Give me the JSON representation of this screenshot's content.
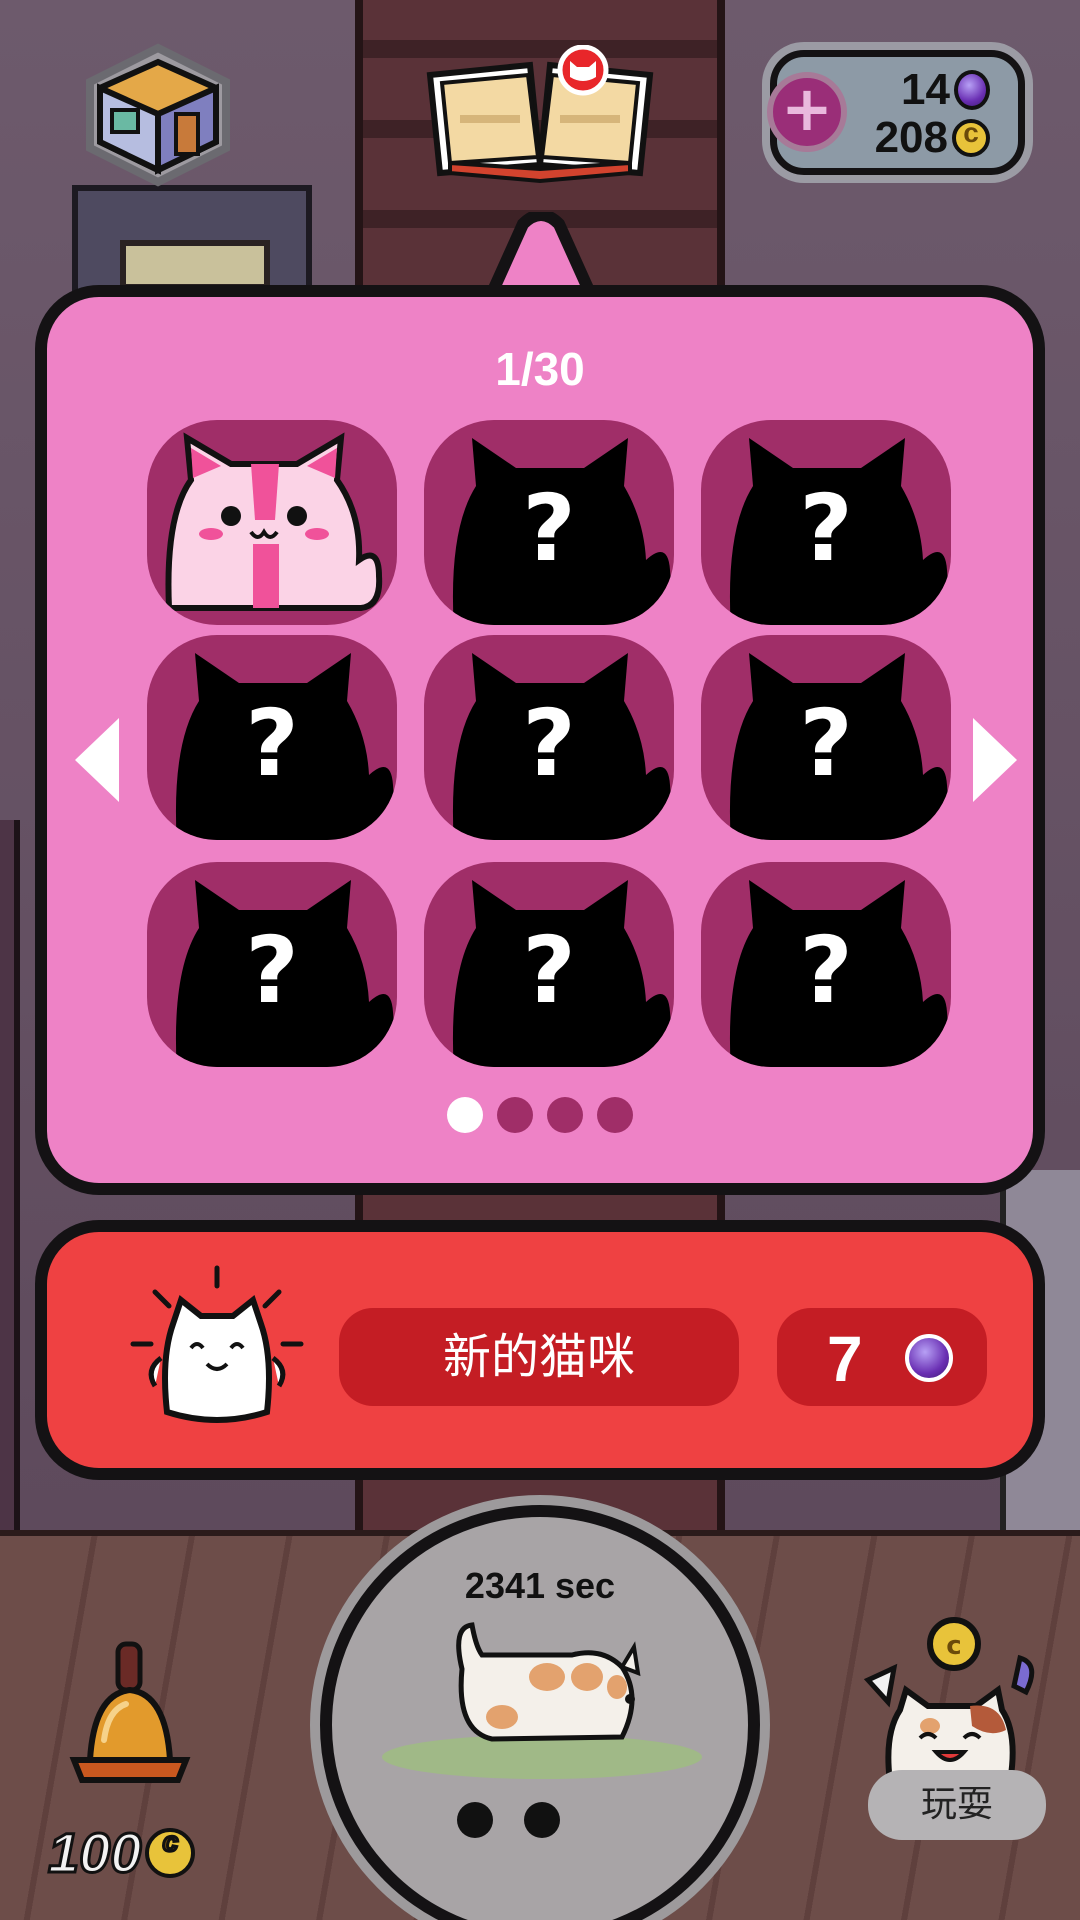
{
  "top_bar": {
    "gems": "14",
    "coins": "208",
    "plus_label": "+"
  },
  "album": {
    "page_indicator": "1/30",
    "cells": [
      {
        "state": "unlocked",
        "label": ""
      },
      {
        "state": "locked",
        "label": "?"
      },
      {
        "state": "locked",
        "label": "?"
      },
      {
        "state": "locked",
        "label": "?"
      },
      {
        "state": "locked",
        "label": "?"
      },
      {
        "state": "locked",
        "label": "?"
      },
      {
        "state": "locked",
        "label": "?"
      },
      {
        "state": "locked",
        "label": "?"
      },
      {
        "state": "locked",
        "label": "?"
      }
    ],
    "pages_total": 4,
    "active_page": 0
  },
  "new_cat": {
    "label": "新的猫咪",
    "price": "7"
  },
  "bottom": {
    "timer": "2341 sec",
    "bell_price": "100",
    "play_label": "玩耍"
  },
  "colors": {
    "album_bg": "#ee82c6",
    "cell_bg": "#a02e68",
    "newcat_bg": "#ef4142",
    "button_dark_red": "#c41d24"
  },
  "icons": {
    "room": "room-box-icon",
    "book": "cat-album-book-icon",
    "gem": "purple-gem-icon",
    "coin": "gold-coin-icon",
    "bell": "bell-icon",
    "play": "play-cat-icon"
  }
}
